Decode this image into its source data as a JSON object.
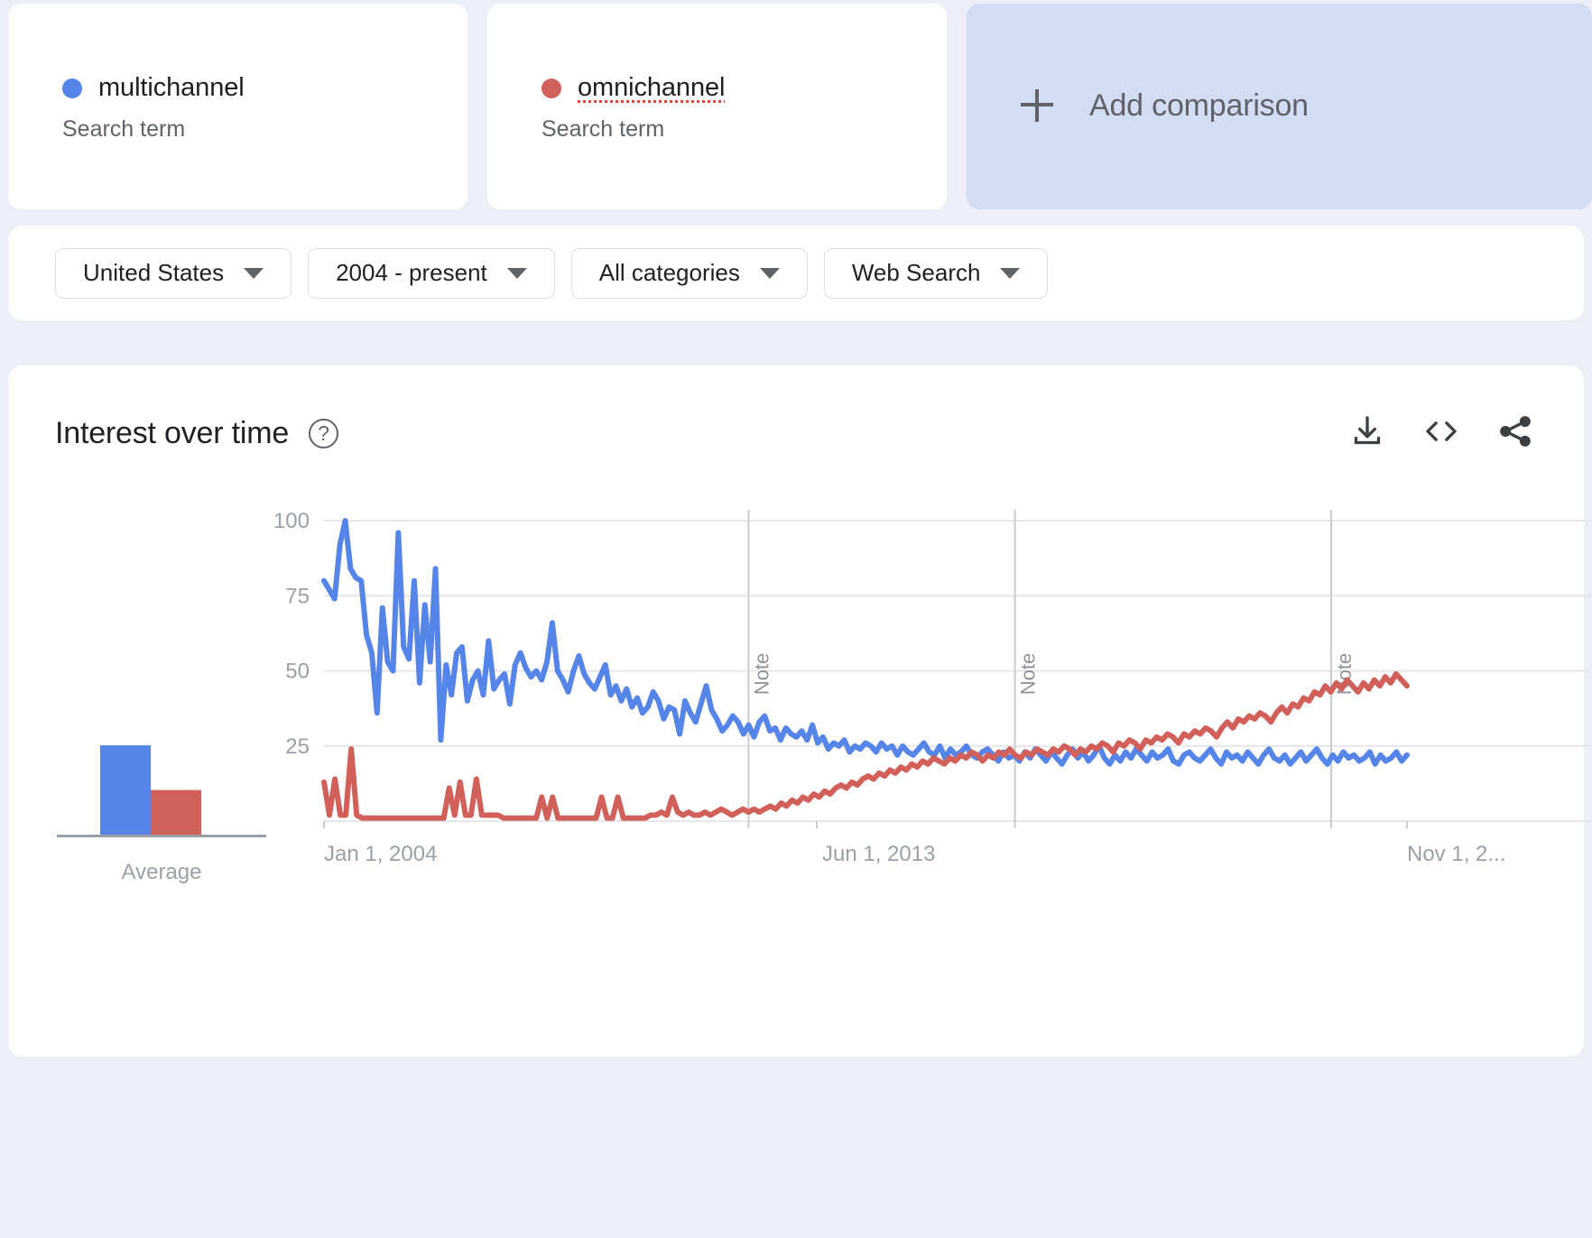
{
  "terms": [
    {
      "name": "multichannel",
      "type_label": "Search term",
      "color": "#5585e8",
      "misspelled": false
    },
    {
      "name": "omnichannel",
      "type_label": "Search term",
      "color": "#d1605a",
      "misspelled": true
    }
  ],
  "add_comparison": {
    "label": "Add comparison",
    "icon": "plus-icon"
  },
  "filters": [
    {
      "name": "location",
      "value": "United States"
    },
    {
      "name": "time",
      "value": "2004 - present"
    },
    {
      "name": "category",
      "value": "All categories"
    },
    {
      "name": "search_type",
      "value": "Web Search"
    }
  ],
  "panel": {
    "title": "Interest over time",
    "help_icon": "?",
    "actions": [
      {
        "name": "download-icon",
        "label": "Download CSV"
      },
      {
        "name": "embed-icon",
        "label": "Embed"
      },
      {
        "name": "share-icon",
        "label": "Share"
      }
    ]
  },
  "chart_data": {
    "type": "line",
    "title": "Interest over time",
    "xlabel": "",
    "ylabel": "",
    "ylim": [
      0,
      100
    ],
    "yticks": [
      25,
      50,
      75,
      100
    ],
    "grid": true,
    "legend_position": "top-cards",
    "xticks": [
      "Jan 1, 2004",
      "Jun 1, 2013",
      "Nov 1, 2..."
    ],
    "annotations": [
      {
        "label": "Note",
        "x_frac": 0.392
      },
      {
        "label": "Note",
        "x_frac": 0.638
      },
      {
        "label": "Note",
        "x_frac": 0.93
      }
    ],
    "average_panel": {
      "label": "Average",
      "values": [
        30,
        15
      ]
    },
    "series": [
      {
        "name": "multichannel",
        "color": "#5585e8",
        "values": [
          80,
          77,
          74,
          92,
          100,
          84,
          81,
          80,
          62,
          56,
          36,
          71,
          53,
          50,
          96,
          58,
          54,
          80,
          46,
          72,
          53,
          84,
          27,
          52,
          42,
          56,
          58,
          40,
          47,
          50,
          42,
          60,
          44,
          47,
          49,
          39,
          52,
          56,
          51,
          48,
          50,
          47,
          53,
          66,
          50,
          47,
          43,
          50,
          55,
          49,
          46,
          44,
          48,
          52,
          42,
          45,
          40,
          44,
          38,
          41,
          36,
          38,
          43,
          40,
          34,
          38,
          37,
          29,
          40,
          36,
          33,
          39,
          45,
          37,
          34,
          30,
          32,
          35,
          33,
          29,
          32,
          28,
          33,
          35,
          30,
          31,
          27,
          31,
          29,
          28,
          30,
          27,
          32,
          26,
          28,
          24,
          26,
          25,
          27,
          23,
          25,
          24,
          26,
          25,
          23,
          26,
          24,
          25,
          22,
          25,
          23,
          22,
          24,
          26,
          23,
          22,
          25,
          21,
          24,
          22,
          23,
          25,
          22,
          21,
          23,
          24,
          22,
          20,
          23,
          21,
          22,
          20,
          23,
          21,
          24,
          22,
          20,
          23,
          21,
          19,
          22,
          24,
          21,
          23,
          20,
          22,
          25,
          21,
          19,
          22,
          20,
          23,
          21,
          24,
          22,
          20,
          23,
          21,
          22,
          24,
          20,
          19,
          22,
          23,
          21,
          20,
          22,
          24,
          21,
          19,
          23,
          21,
          22,
          20,
          23,
          21,
          19,
          22,
          24,
          21,
          20,
          22,
          19,
          21,
          23,
          20,
          22,
          24,
          21,
          19,
          22,
          20,
          23,
          21,
          22,
          20,
          21,
          23,
          19,
          22,
          20,
          21,
          23,
          20,
          22
        ]
      },
      {
        "name": "omnichannel",
        "color": "#d1605a",
        "values": [
          13,
          2,
          14,
          2,
          2,
          24,
          2,
          1,
          1,
          1,
          1,
          1,
          1,
          1,
          1,
          1,
          1,
          1,
          1,
          1,
          1,
          1,
          1,
          11,
          2,
          13,
          2,
          2,
          14,
          2,
          2,
          2,
          2,
          1,
          1,
          1,
          1,
          1,
          1,
          1,
          8,
          1,
          8,
          1,
          1,
          1,
          1,
          1,
          1,
          1,
          1,
          8,
          1,
          1,
          8,
          1,
          1,
          1,
          1,
          1,
          2,
          2,
          3,
          2,
          8,
          3,
          2,
          3,
          2,
          2,
          3,
          2,
          3,
          4,
          3,
          2,
          3,
          4,
          3,
          4,
          3,
          4,
          5,
          4,
          6,
          5,
          7,
          6,
          8,
          7,
          9,
          8,
          10,
          9,
          11,
          12,
          11,
          13,
          12,
          14,
          15,
          14,
          16,
          15,
          17,
          16,
          18,
          17,
          19,
          18,
          20,
          19,
          21,
          20,
          19,
          21,
          20,
          22,
          21,
          23,
          22,
          20,
          22,
          21,
          23,
          22,
          24,
          22,
          21,
          23,
          22,
          24,
          23,
          22,
          24,
          23,
          25,
          24,
          22,
          24,
          23,
          25,
          24,
          26,
          25,
          23,
          26,
          25,
          27,
          26,
          24,
          27,
          26,
          28,
          27,
          29,
          28,
          26,
          29,
          28,
          30,
          29,
          31,
          30,
          28,
          31,
          33,
          31,
          34,
          33,
          35,
          34,
          36,
          35,
          33,
          36,
          38,
          36,
          39,
          38,
          41,
          40,
          43,
          42,
          45,
          43,
          46,
          44,
          47,
          45,
          43,
          46,
          44,
          47,
          45,
          48,
          46,
          49,
          47,
          45
        ]
      }
    ]
  }
}
